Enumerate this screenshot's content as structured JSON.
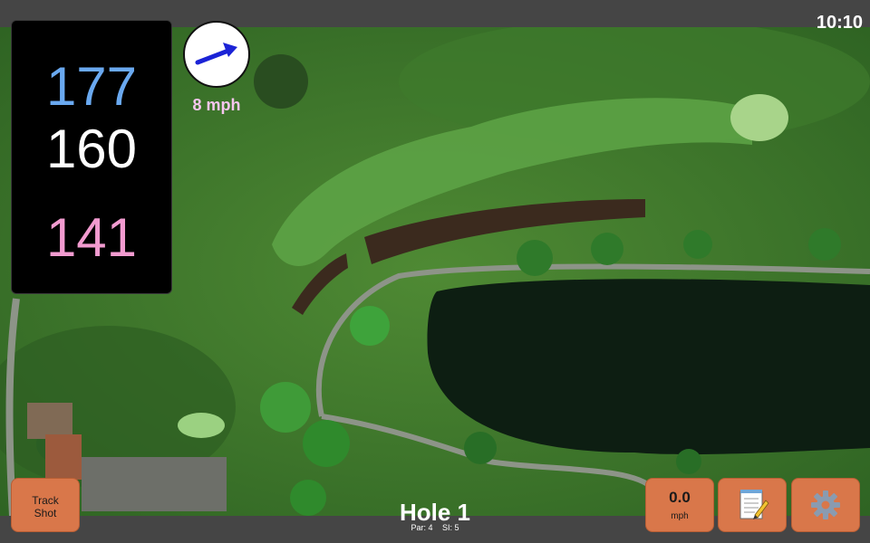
{
  "status_bar": {
    "time": "10:10"
  },
  "distances": {
    "back": "177",
    "middle": "160",
    "front": "141"
  },
  "wind": {
    "speed": "8 mph",
    "direction_icon": "arrow-up-right-icon"
  },
  "hole": {
    "title": "Hole 1",
    "par": "Par: 4",
    "stroke_index": "SI: 5"
  },
  "buttons": {
    "track_shot_line1": "Track",
    "track_shot_line2": "Shot",
    "speed_value": "0.0",
    "speed_unit": "mph",
    "notes_icon": "notepad-icon",
    "settings_icon": "gear-icon"
  },
  "colors": {
    "back_distance": "#6aa9f0",
    "middle_distance": "#ffffff",
    "front_distance": "#f29bd0",
    "button": "#d9774a",
    "wind_text": "#f6c6ee"
  }
}
